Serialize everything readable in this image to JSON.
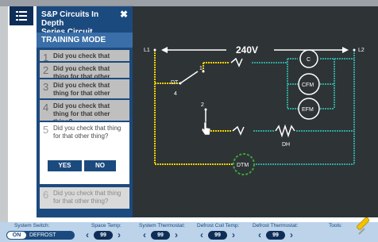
{
  "panel": {
    "title_line1": "S&P Circuits In Depth",
    "title_line2": "Series Circuit",
    "mode": "TRAINING MODE",
    "steps": [
      {
        "num": "1",
        "text": "Did you check that thing"
      },
      {
        "num": "2",
        "text": "Did you check that thing for that other thing?"
      },
      {
        "num": "3",
        "text": "Did you check that thing for that other thing?"
      },
      {
        "num": "4",
        "text": "Did you check that thing for that other thing?"
      },
      {
        "num": "5",
        "text": "Did you check that thing for that other thing?"
      },
      {
        "num": "6",
        "text": "Did you check that thing for that other thing?"
      }
    ],
    "yes_label": "YES",
    "no_label": "NO"
  },
  "diagram": {
    "l1": "L1",
    "l2": "L2",
    "voltage": "240V",
    "dt": "DT",
    "n1": "1",
    "n2": "2",
    "n4": "4",
    "c": "C",
    "cfm": "CFM",
    "efm": "EFM",
    "dh": "DH",
    "dtm": "DTM",
    "colors": {
      "line_yellow": "#f0d000",
      "line_teal": "#2fa59a",
      "ring_green": "#3aa63a"
    }
  },
  "bottom": {
    "system_switch_label": "System Switch:",
    "switch_on": "ON",
    "switch_off": "DEFROST",
    "space_temp_label": "Space Temp:",
    "space_temp": "99",
    "sys_thermo_label": "System Thermostat:",
    "sys_thermo": "99",
    "defrost_coil_label": "Defrost Coil Temp:",
    "defrost_coil": "99",
    "defrost_thermo_label": "Defrost Thermostat:",
    "defrost_thermo": "99",
    "tools_label": "Tools:"
  }
}
